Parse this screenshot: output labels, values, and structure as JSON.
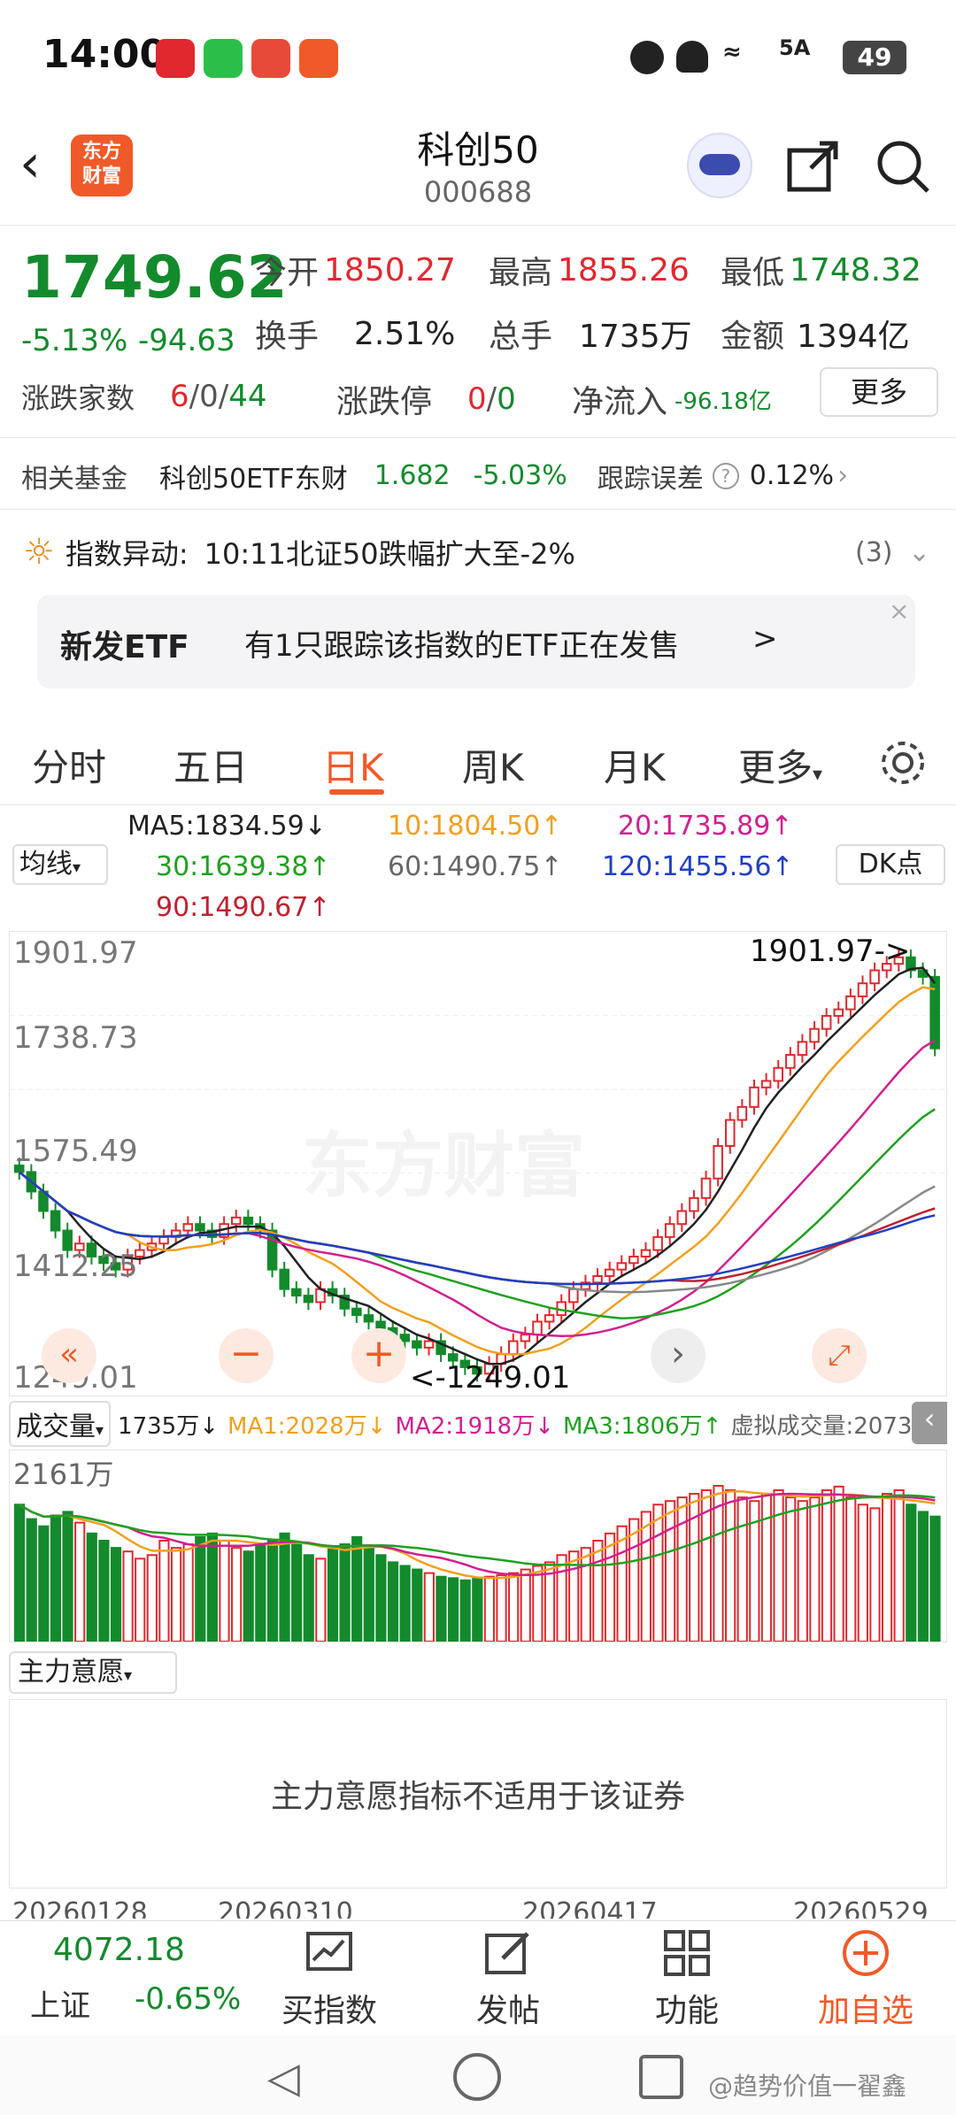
{
  "status": {
    "time": "14:00",
    "battery": "49",
    "network": "5A"
  },
  "header": {
    "title": "科创50",
    "code": "000688",
    "logo_line1": "东方",
    "logo_line2": "财富"
  },
  "quote": {
    "price": "1749.62",
    "change_pct": "-5.13%",
    "change_abs": "-94.63",
    "open_label": "今开",
    "open": "1850.27",
    "high_label": "最高",
    "high": "1855.26",
    "low_label": "最低",
    "low": "1748.32",
    "turnover_label": "换手",
    "turnover": "2.51%",
    "volume_label": "总手",
    "volume": "1735万",
    "amount_label": "金额",
    "amount": "1394亿",
    "breadth_label": "涨跌家数",
    "breadth_up": "6",
    "breadth_flat": "0",
    "breadth_down": "44",
    "limit_label": "涨跌停",
    "limit_up": "0",
    "limit_down": "0",
    "inflow_label": "净流入",
    "inflow": "-96.18亿",
    "more_button": "更多"
  },
  "fund": {
    "label": "相关基金",
    "name": "科创50ETF东财",
    "price": "1.682",
    "change": "-5.03%",
    "error_label": "跟踪误差",
    "error": "0.12%"
  },
  "alert": {
    "label": "指数异动:",
    "text": "10:11北证50跌幅扩大至-2%",
    "count": "(3)"
  },
  "banner": {
    "tag": "新发ETF",
    "text": "有1只跟踪该指数的ETF正在发售",
    "arrow": ">"
  },
  "tabs": [
    "分时",
    "五日",
    "日K",
    "周K",
    "月K",
    "更多"
  ],
  "active_tab": "日K",
  "ma_bar": {
    "selector": "均线",
    "ma5": "MA5:1834.59↓",
    "ma10": "10:1804.50↑",
    "ma20": "20:1735.89↑",
    "ma30": "30:1639.38↑",
    "ma60": "60:1490.75↑",
    "ma120": "120:1455.56↑",
    "ma90": "90:1490.67↑",
    "dk": "DK点"
  },
  "chart_data": {
    "type": "candlestick",
    "yticks": [
      "1901.97",
      "1738.73",
      "1575.49",
      "1412.25",
      "1249.01"
    ],
    "ylim": [
      1249.01,
      1901.97
    ],
    "max_label": "1901.97->",
    "min_label": "<-1249.01",
    "watermark": "东方财富",
    "closes": [
      1560,
      1530,
      1500,
      1470,
      1440,
      1450,
      1430,
      1420,
      1410,
      1430,
      1440,
      1450,
      1460,
      1470,
      1480,
      1470,
      1460,
      1480,
      1490,
      1480,
      1470,
      1410,
      1380,
      1370,
      1360,
      1380,
      1370,
      1350,
      1340,
      1330,
      1320,
      1310,
      1300,
      1290,
      1300,
      1280,
      1270,
      1260,
      1250,
      1265,
      1280,
      1300,
      1310,
      1330,
      1340,
      1360,
      1380,
      1390,
      1400,
      1410,
      1420,
      1430,
      1440,
      1460,
      1480,
      1500,
      1520,
      1550,
      1600,
      1640,
      1660,
      1690,
      1700,
      1720,
      1740,
      1760,
      1780,
      1800,
      1810,
      1830,
      1850,
      1870,
      1880,
      1890,
      1870,
      1860,
      1750
    ],
    "ma_colors": {
      "ma5": "#222222",
      "ma10": "#f0a020",
      "ma20": "#d02090",
      "ma30": "#20a020",
      "ma60": "#888888",
      "ma120": "#2040c0",
      "ma90": "#c02030"
    }
  },
  "volume_bar": {
    "selector": "成交量",
    "vol": "1735万↓",
    "ma1": "MA1:2028万↓",
    "ma2": "MA2:1918万↓",
    "ma3": "MA3:1806万↑",
    "virtual": "虚拟成交量:2073万",
    "max": "2161万"
  },
  "volume_data": [
    1900,
    1700,
    1600,
    1750,
    1800,
    1650,
    1500,
    1400,
    1300,
    1250,
    1150,
    1200,
    1400,
    1300,
    1350,
    1450,
    1500,
    1400,
    1300,
    1250,
    1350,
    1400,
    1500,
    1350,
    1200,
    1150,
    1300,
    1350,
    1450,
    1300,
    1200,
    1100,
    1050,
    1000,
    950,
    900,
    880,
    850,
    870,
    900,
    920,
    950,
    1000,
    1050,
    1100,
    1200,
    1250,
    1300,
    1400,
    1500,
    1600,
    1700,
    1800,
    1900,
    1950,
    2000,
    2050,
    2100,
    2161,
    2100,
    2000,
    1950,
    2050,
    2100,
    2000,
    1950,
    2000,
    2100,
    2150,
    2000,
    1900,
    1850,
    2050,
    2100,
    1900,
    1800,
    1735
  ],
  "intent": {
    "selector": "主力意愿",
    "message": "主力意愿指标不适用于该证券"
  },
  "dates": [
    "20260128",
    "20260310",
    "20260417",
    "20260529"
  ],
  "bottom_nav": {
    "index_value": "4072.18",
    "index_name": "上证",
    "index_change": "-0.65%",
    "buy_index": "买指数",
    "post": "发帖",
    "functions": "功能",
    "add_watch": "加自选"
  },
  "watermark_user": "@趋势价值一翟鑫"
}
